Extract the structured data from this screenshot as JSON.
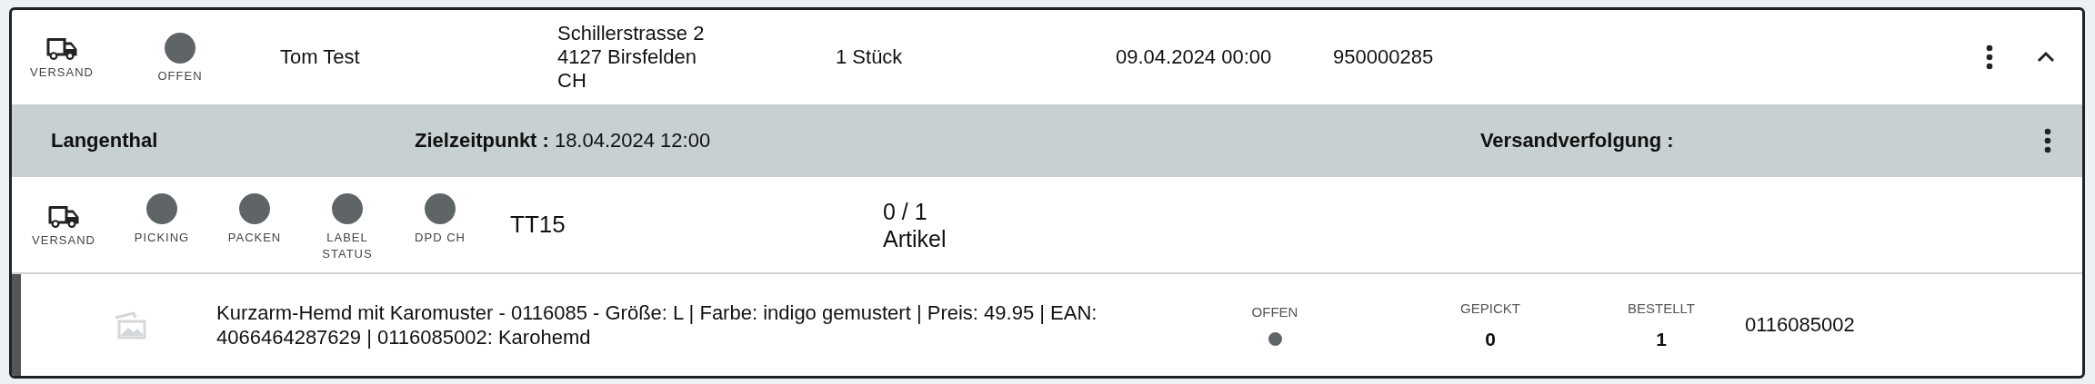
{
  "order": {
    "shipping_label": "VERSAND",
    "status": {
      "label": "OFFEN",
      "color": "#5f6566"
    },
    "customer": "Tom Test",
    "address": [
      "Schillerstrasse 2",
      "4127 Birsfelden",
      "CH"
    ],
    "quantity": "1 Stück",
    "date": "09.04.2024 00:00",
    "number": "950000285",
    "expanded": true
  },
  "shipment": {
    "location": "Langenthal",
    "target_label": "Zielzeitpunkt :",
    "target_value": "18.04.2024 12:00",
    "tracking_label": "Versandverfolgung :"
  },
  "package": {
    "shipping_label": "VERSAND",
    "statuses": [
      {
        "label": "PICKING",
        "color": "#5f6566"
      },
      {
        "label": "PACKEN",
        "color": "#5f6566"
      },
      {
        "label": "LABEL STATUS",
        "color": "#5f6566"
      },
      {
        "label": "DPD CH",
        "color": "#5f6566"
      }
    ],
    "code": "TT15",
    "count": "0 / 1",
    "count_unit": "Artikel"
  },
  "items": [
    {
      "description": "Kurzarm-Hemd mit Karomuster - 0116085 - Größe: L | Farbe: indigo gemustert | Preis: 49.95 | EAN: 4066464287629 | 0116085002: Karohemd",
      "status": {
        "label": "OFFEN",
        "color": "#5f6566"
      },
      "picked_label": "GEPICKT",
      "picked": "0",
      "ordered_label": "BESTELLT",
      "ordered": "1",
      "sku": "0116085002"
    }
  ]
}
